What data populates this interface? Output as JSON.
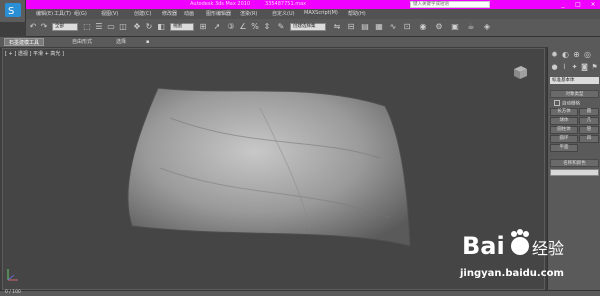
{
  "titlebar": {
    "app_title": "Autodesk 3ds Max  2010",
    "file_name": "335487751.max",
    "search_placeholder": "键入关键字或短语",
    "win_buttons": [
      "_",
      "□",
      "×"
    ]
  },
  "menubar": {
    "items": [
      "编辑(E)",
      "工具(T)",
      "组(G)",
      "视图(V)",
      "创建(C)",
      "修改器",
      "动画",
      "图形编辑器",
      "渲染(R)",
      "自定义(U)",
      "MAXScript(M)",
      "帮助(H)"
    ]
  },
  "toolbar": {
    "selection_filter": "全部",
    "reference_coord": "视图",
    "named_selection": "创建选择集"
  },
  "ribbon": {
    "tabs": [
      "石墨建模工具",
      "自由形式",
      "选择"
    ],
    "active_tab": 0
  },
  "viewport": {
    "label": "[ + ] 透视 ] 平滑 + 高光 ]"
  },
  "command_panel": {
    "dropdown": "标准基本体",
    "object_type_header": "对象类型",
    "autogrid_label": "自动栅格",
    "buttons": [
      [
        "长方体",
        "圆"
      ],
      [
        "球体",
        "几"
      ],
      [
        "圆柱体",
        "管"
      ],
      [
        "圆环",
        "四"
      ],
      [
        "平面",
        ""
      ]
    ],
    "name_color_header": "名称和颜色"
  },
  "statusbar": {
    "frame": "0 / 100"
  },
  "watermark": {
    "brand": "Bai",
    "brand_cn": "经验",
    "url": "jingyan.baidu.com"
  },
  "colors": {
    "title_bg": "#f000ff",
    "viewport_bg": "#454545",
    "panel_bg": "#5a5a5a"
  }
}
